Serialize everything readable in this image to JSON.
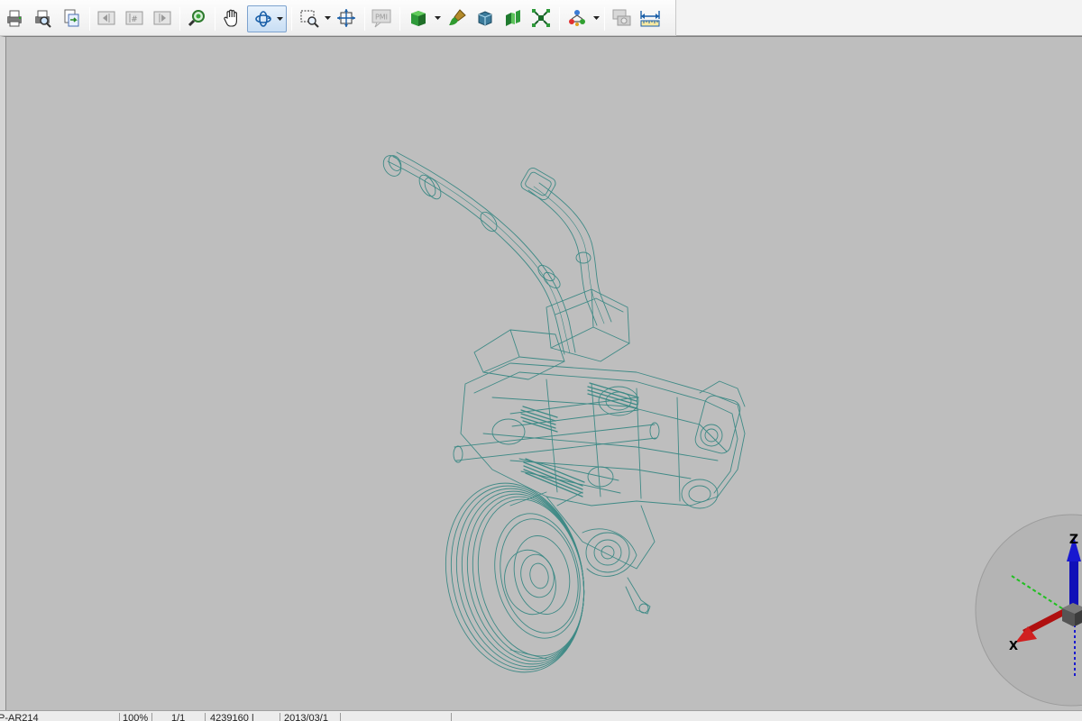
{
  "toolbar": {
    "buttons": [
      {
        "name": "print-icon",
        "tooltip": "Print"
      },
      {
        "name": "print-preview-icon",
        "tooltip": "Print Preview"
      },
      {
        "name": "export-icon",
        "tooltip": "Export"
      },
      {
        "name": "prev-page-icon",
        "tooltip": "Previous Page"
      },
      {
        "name": "page-number-icon",
        "tooltip": "Page"
      },
      {
        "name": "next-page-icon",
        "tooltip": "Next Page"
      },
      {
        "name": "find-icon",
        "tooltip": "Find"
      },
      {
        "name": "pan-hand-icon",
        "tooltip": "Pan"
      },
      {
        "name": "rotate-icon",
        "tooltip": "Rotate"
      },
      {
        "name": "zoom-window-icon",
        "tooltip": "Zoom Window"
      },
      {
        "name": "fit-all-icon",
        "tooltip": "Fit All"
      },
      {
        "name": "pmi-icon",
        "tooltip": "PMI"
      },
      {
        "name": "shaded-cube-icon",
        "tooltip": "Render Mode"
      },
      {
        "name": "paint-brush-icon",
        "tooltip": "Appearance"
      },
      {
        "name": "wireframe-cube-icon",
        "tooltip": "Wireframe"
      },
      {
        "name": "section-icon",
        "tooltip": "Section"
      },
      {
        "name": "explode-icon",
        "tooltip": "Explode"
      },
      {
        "name": "assembly-icon",
        "tooltip": "Assembly"
      },
      {
        "name": "camera-views-icon",
        "tooltip": "Views"
      },
      {
        "name": "measure-icon",
        "tooltip": "Measure"
      }
    ],
    "pmi_label": "PMI"
  },
  "viewport": {
    "background_color": "#bebebe",
    "wire_color": "#3f8a86"
  },
  "triad": {
    "z_label": "Z",
    "x_label": "X"
  },
  "statusbar": {
    "file": "P-AR214",
    "zoom": "100%",
    "page": "1/1",
    "size": "4239160 |",
    "date": "2013/03/1"
  }
}
